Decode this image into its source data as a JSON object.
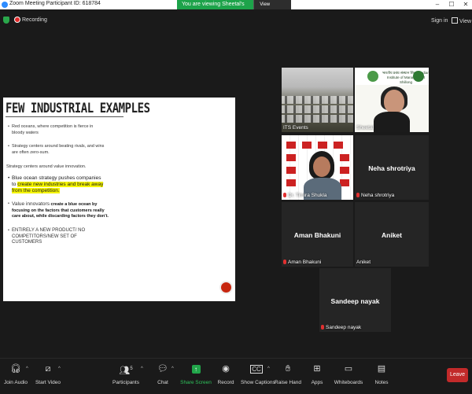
{
  "window": {
    "title": "Zoom Meeting Participant ID: 618784"
  },
  "banner": {
    "viewing_text": "You are viewing Sheetal's screen",
    "view_options": "View Options"
  },
  "topbar": {
    "recording": "Recording",
    "sign_in": "Sign in",
    "view": "View"
  },
  "slide": {
    "title": "FEW INDUSTRIAL EXAMPLES",
    "b1": "Red oceans, where competition is fierce in bloody waters",
    "b2": "Strategy centers around beating rivals, and wins are often zero-sum.",
    "plain": "Strategy centers around value innovation.",
    "b3_a": "Blue ocean strategy pushes companies to",
    "b3_b": "create new industries and break away from the competition.",
    "b4_a": "Value innovators",
    "b4_b": "create a blue ocean by focusing on the factors that customers really care about, while discarding factors they don't.",
    "b5": "ENTIRELY A NEW PRODUCT/ NO COMPETITORS/NEW SET OF CUSTOMERS"
  },
  "participants": {
    "its_events": "ITS Events",
    "sheetal": "Sheetal",
    "sheetal_header": "भारतीय प्रबंध संस्थान शिलांग\nIndian Institute of Management Shillong",
    "shukla": "Dr. Timira Shukla",
    "neha": "Neha shrotriya",
    "aman": "Aman Bhakuni",
    "aniket": "Aniket",
    "sandeep": "Sandeep nayak"
  },
  "toolbar": {
    "join_audio": "Join Audio",
    "start_video": "Start Video",
    "participants": "Participants",
    "participants_count": "5",
    "chat": "Chat",
    "share_screen": "Share Screen",
    "record": "Record",
    "show_captions": "Show Captions",
    "raise_hand": "Raise Hand",
    "apps": "Apps",
    "whiteboards": "Whiteboards",
    "notes": "Notes",
    "leave": "Leave"
  },
  "colors": {
    "accent_green": "#1da34a",
    "leave_red": "#c22a2a",
    "highlight": "#f5f500"
  }
}
